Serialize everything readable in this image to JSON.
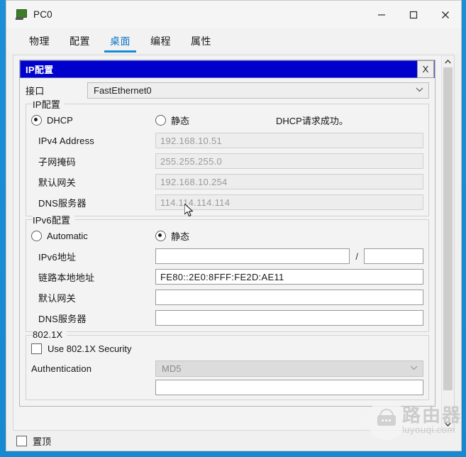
{
  "window": {
    "title": "PC0",
    "icon": "pc-device-icon",
    "controls": {
      "minimize": "–",
      "maximize": "□",
      "close": "✕"
    }
  },
  "tabs": [
    {
      "label": "物理",
      "active": false
    },
    {
      "label": "配置",
      "active": false
    },
    {
      "label": "桌面",
      "active": true
    },
    {
      "label": "编程",
      "active": false
    },
    {
      "label": "属性",
      "active": false
    }
  ],
  "dialog": {
    "title": "IP配置",
    "close_label": "X",
    "interface": {
      "label": "接口",
      "value": "FastEthernet0",
      "chevron": "⌄"
    },
    "ipv4": {
      "legend": "IP配置",
      "mode_dhcp": {
        "label": "DHCP",
        "checked": true
      },
      "mode_static": {
        "label": "静态",
        "checked": false
      },
      "status": "DHCP请求成功。",
      "fields": [
        {
          "label": "IPv4 Address",
          "value": "192.168.10.51",
          "enabled": false
        },
        {
          "label": "子网掩码",
          "value": "255.255.255.0",
          "enabled": false
        },
        {
          "label": "默认网关",
          "value": "192.168.10.254",
          "enabled": false
        },
        {
          "label": "DNS服务器",
          "value": "114.114.114.114",
          "enabled": false
        }
      ]
    },
    "ipv6": {
      "legend": "IPv6配置",
      "mode_automatic": {
        "label": "Automatic",
        "checked": false
      },
      "mode_static": {
        "label": "静态",
        "checked": true
      },
      "address": {
        "label": "IPv6地址",
        "value": "",
        "prefix": "",
        "separator": "/"
      },
      "link_local": {
        "label": "链路本地地址",
        "value": "FE80::2E0:8FFF:FE2D:AE11"
      },
      "gateway": {
        "label": "默认网关",
        "value": ""
      },
      "dns": {
        "label": "DNS服务器",
        "value": ""
      }
    },
    "dot1x": {
      "legend": "802.1X",
      "use_security": {
        "label": "Use 802.1X Security",
        "checked": false
      },
      "authentication": {
        "label": "Authentication",
        "value": "MD5",
        "enabled": false,
        "chevron": "⌄"
      }
    }
  },
  "bottom": {
    "always_on_top": {
      "label": "置顶",
      "checked": false
    }
  },
  "scrollbar": {
    "up_arrow": "∧",
    "down_arrow": "∨"
  },
  "watermark": {
    "cn": "路由器",
    "en": "luyouqi.com"
  },
  "colors": {
    "desktop": "#1b8ad4",
    "dialog_title": "#0000cd",
    "tab_active": "#1b8ad4",
    "disabled_text": "#9a9a9a"
  }
}
